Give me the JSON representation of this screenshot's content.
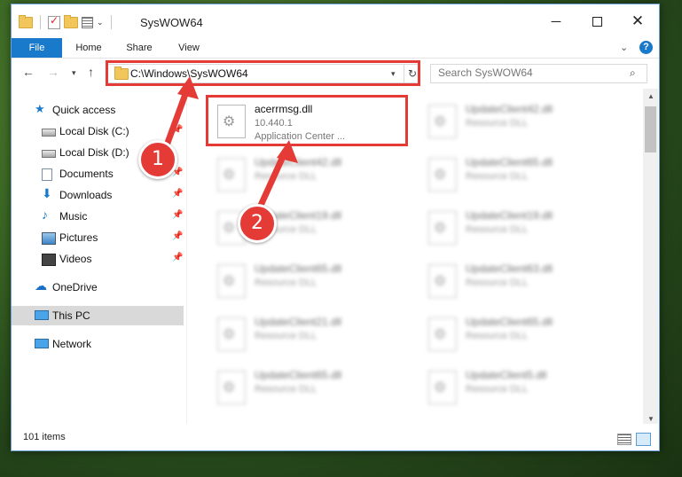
{
  "window": {
    "title": "SysWOW64",
    "min_glyph": "─",
    "close_glyph": "✕"
  },
  "ribbon": {
    "tabs": [
      "File",
      "Home",
      "Share",
      "View"
    ],
    "chevron": "⌄",
    "help": "?"
  },
  "nav": {
    "back": "←",
    "forward": "→",
    "recent": "▾",
    "up": "↑",
    "address": "C:\\Windows\\SysWOW64",
    "refresh": "↻"
  },
  "search": {
    "placeholder": "Search SysWOW64",
    "icon": "⌕"
  },
  "sidebar": {
    "items": [
      {
        "label": "Quick access",
        "icon": "star-icon"
      },
      {
        "label": "Local Disk (C:)",
        "icon": "drive-icon"
      },
      {
        "label": "Local Disk (D:)",
        "icon": "drive-icon"
      },
      {
        "label": "Documents",
        "icon": "documents-icon"
      },
      {
        "label": "Downloads",
        "icon": "download-icon"
      },
      {
        "label": "Music",
        "icon": "music-icon"
      },
      {
        "label": "Pictures",
        "icon": "pictures-icon"
      },
      {
        "label": "Videos",
        "icon": "video-icon"
      },
      {
        "label": "OneDrive",
        "icon": "cloud-icon"
      },
      {
        "label": "This PC",
        "icon": "computer-icon"
      },
      {
        "label": "Network",
        "icon": "network-icon"
      }
    ],
    "pin_glyph": "📌"
  },
  "files": [
    {
      "name": "acerrmsg.dll",
      "line1": "10.440.1",
      "line2": "Application Center ..."
    },
    {
      "name": "UpdateClient42.dll",
      "line1": "Resource DLL"
    },
    {
      "name": "UpdateClient42.dll",
      "line1": "Resource DLL"
    },
    {
      "name": "UpdateClient65.dll",
      "line1": "Resource DLL"
    },
    {
      "name": "UpdateClient19.dll",
      "line1": "Resource DLL"
    },
    {
      "name": "UpdateClient19.dll",
      "line1": "Resource DLL"
    },
    {
      "name": "UpdateClient65.dll",
      "line1": "Resource DLL"
    },
    {
      "name": "UpdateClient63.dll",
      "line1": "Resource DLL"
    },
    {
      "name": "UpdateClient21.dll",
      "line1": "Resource DLL"
    },
    {
      "name": "UpdateClient65.dll",
      "line1": "Resource DLL"
    },
    {
      "name": "UpdateClient65.dll",
      "line1": "Resource DLL"
    },
    {
      "name": "UpdateClient5.dll",
      "line1": "Resource DLL"
    }
  ],
  "status": {
    "count": "101 items"
  },
  "annotations": {
    "badge1": "1",
    "badge2": "2",
    "color": "#e53b36"
  },
  "colors": {
    "accent": "#1979ca",
    "selection": "#cce8ff"
  }
}
